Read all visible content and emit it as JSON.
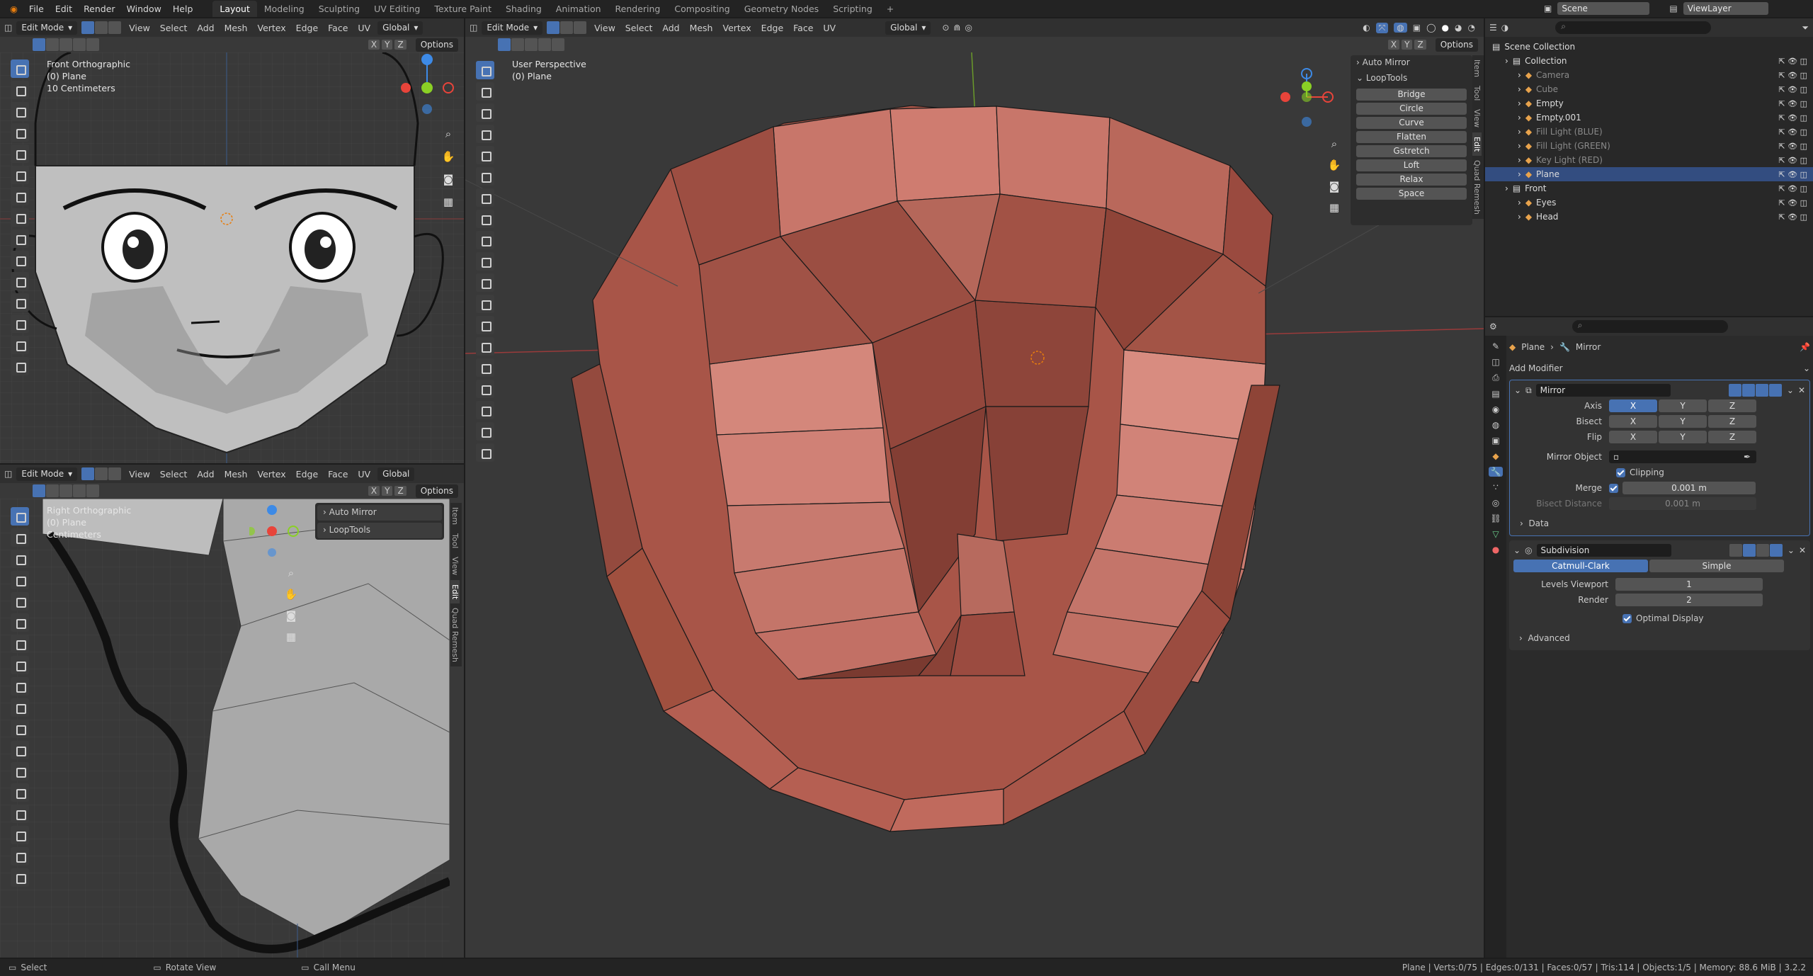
{
  "topbar": {
    "menus": [
      "File",
      "Edit",
      "Render",
      "Window",
      "Help"
    ],
    "workspaces": [
      "Layout",
      "Modeling",
      "Sculpting",
      "UV Editing",
      "Texture Paint",
      "Shading",
      "Animation",
      "Rendering",
      "Compositing",
      "Geometry Nodes",
      "Scripting",
      "+"
    ],
    "active_workspace": "Layout",
    "scene": "Scene",
    "view_layer": "ViewLayer"
  },
  "viewport_header": {
    "mode": "Edit Mode",
    "menus": [
      "View",
      "Select",
      "Add",
      "Mesh",
      "Vertex",
      "Edge",
      "Face",
      "UV"
    ],
    "orientation": "Global",
    "axes": [
      "X",
      "Y",
      "Z"
    ],
    "options": "Options"
  },
  "front_view": {
    "view_name": "Front Orthographic",
    "object": "(0) Plane",
    "scale": "10 Centimeters"
  },
  "right_view": {
    "view_name": "Right Orthographic",
    "object": "(0) Plane",
    "scale": "Centimeters",
    "panels": [
      "Auto Mirror",
      "LoopTools"
    ],
    "tabs": [
      "Item",
      "Tool",
      "View",
      "Edit",
      "Quad Remesh"
    ]
  },
  "main_view": {
    "view_name": "User Perspective",
    "object": "(0) Plane",
    "panel_auto_mirror": "Auto Mirror",
    "panel_looptools": "LoopTools",
    "looptools_buttons": [
      "Bridge",
      "Circle",
      "Curve",
      "Flatten",
      "Gstretch",
      "Loft",
      "Relax",
      "Space"
    ],
    "tabs": [
      "Item",
      "Tool",
      "View",
      "Edit",
      "Quad Remesh"
    ]
  },
  "outliner": {
    "root": "Scene Collection",
    "rows": [
      {
        "label": "Collection",
        "depth": 1,
        "dim": false,
        "selected": false
      },
      {
        "label": "Camera",
        "depth": 2,
        "dim": true,
        "selected": false
      },
      {
        "label": "Cube",
        "depth": 2,
        "dim": true,
        "selected": false
      },
      {
        "label": "Empty",
        "depth": 2,
        "dim": false,
        "selected": false
      },
      {
        "label": "Empty.001",
        "depth": 2,
        "dim": false,
        "selected": false
      },
      {
        "label": "Fill Light (BLUE)",
        "depth": 2,
        "dim": true,
        "selected": false
      },
      {
        "label": "Fill Light (GREEN)",
        "depth": 2,
        "dim": true,
        "selected": false
      },
      {
        "label": "Key Light (RED)",
        "depth": 2,
        "dim": true,
        "selected": false
      },
      {
        "label": "Plane",
        "depth": 2,
        "dim": false,
        "selected": true
      },
      {
        "label": "Front",
        "depth": 1,
        "dim": false,
        "selected": false
      },
      {
        "label": "Eyes",
        "depth": 2,
        "dim": false,
        "selected": false
      },
      {
        "label": "Head",
        "depth": 2,
        "dim": false,
        "selected": false
      }
    ]
  },
  "properties": {
    "breadcrumb_object": "Plane",
    "breadcrumb_modifier": "Mirror",
    "add_modifier": "Add Modifier",
    "mirror": {
      "name": "Mirror",
      "axis_label": "Axis",
      "bisect_label": "Bisect",
      "flip_label": "Flip",
      "xyz": [
        "X",
        "Y",
        "Z"
      ],
      "mirror_object_label": "Mirror Object",
      "clipping_label": "Clipping",
      "merge_label": "Merge",
      "merge_value": "0.001 m",
      "bisect_distance_label": "Bisect Distance",
      "bisect_distance_value": "0.001 m",
      "data_label": "Data"
    },
    "subdivision": {
      "name": "Subdivision",
      "catmull": "Catmull-Clark",
      "simple": "Simple",
      "levels_label": "Levels Viewport",
      "levels_value": "1",
      "render_label": "Render",
      "render_value": "2",
      "optimal_label": "Optimal Display",
      "advanced_label": "Advanced"
    }
  },
  "statusbar": {
    "select": "Select",
    "rotate": "Rotate View",
    "menu": "Call Menu",
    "stats": "Plane | Verts:0/75 | Edges:0/131 | Faces:0/57 | Tris:114 | Objects:1/5 | Memory: 88.6 MiB | 3.2.2"
  },
  "colors": {
    "accent": "#4772b3",
    "mesh_face": "#c46a5e",
    "axis_red": "#e8443a",
    "axis_green": "#8ad025",
    "axis_blue": "#3d8ae6"
  }
}
